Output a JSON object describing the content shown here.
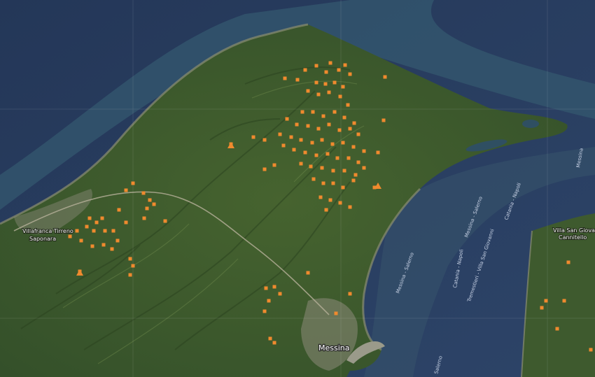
{
  "map": {
    "labels": {
      "villafranca_1": "Villafranca Tirreno",
      "villafranca_2": "Saponara",
      "messina": "Messina",
      "villa_sg_1": "Villa San Giovanni",
      "villa_sg_2": "Cannitello",
      "ferry_1": "Messina - Salerno",
      "ferry_2": "Catania - Napoli",
      "ferry_3": "Messina - Salerno",
      "ferry_4": "Catania - Napoli",
      "ferry_5": "Tremestieri - Villa San Giovanni",
      "ferry_6": "Messina",
      "ferry_7": "Salerno"
    },
    "colors": {
      "sea_deep": "#263a5e",
      "sea_shallow": "#3f6f7a",
      "land": "#3c5a2c",
      "marker": "#f08a2e"
    }
  }
}
